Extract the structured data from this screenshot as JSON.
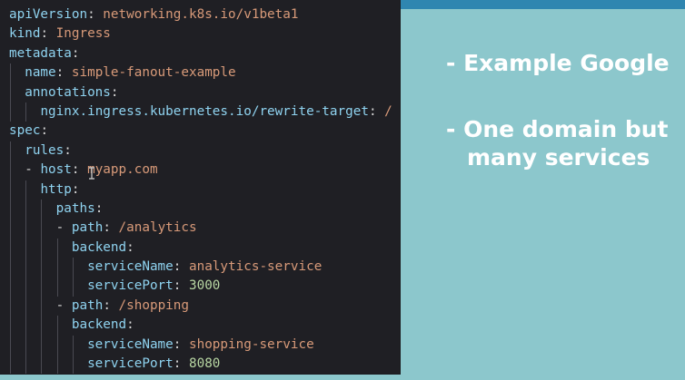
{
  "code_lines": [
    {
      "indent": 0,
      "key": "apiVersion",
      "sep": ": ",
      "value": "networking.k8s.io/v1beta1"
    },
    {
      "indent": 0,
      "key": "kind",
      "sep": ": ",
      "value": "Ingress"
    },
    {
      "indent": 0,
      "key": "metadata",
      "sep": ":",
      "value": ""
    },
    {
      "indent": 1,
      "key": "name",
      "sep": ": ",
      "value": "simple-fanout-example"
    },
    {
      "indent": 1,
      "key": "annotations",
      "sep": ":",
      "value": ""
    },
    {
      "indent": 2,
      "key": "nginx.ingress.kubernetes.io/rewrite-target",
      "sep": ": ",
      "value": "/"
    },
    {
      "indent": 0,
      "key": "spec",
      "sep": ":",
      "value": ""
    },
    {
      "indent": 1,
      "key": "rules",
      "sep": ":",
      "value": ""
    },
    {
      "indent": 1,
      "dash": "- ",
      "key": "host",
      "sep": ": ",
      "value": "myapp.com"
    },
    {
      "indent": 2,
      "key": "http",
      "sep": ":",
      "value": ""
    },
    {
      "indent": 3,
      "key": "paths",
      "sep": ":",
      "value": ""
    },
    {
      "indent": 3,
      "dash": "- ",
      "key": "path",
      "sep": ": ",
      "value": "/analytics"
    },
    {
      "indent": 4,
      "key": "backend",
      "sep": ":",
      "value": ""
    },
    {
      "indent": 5,
      "key": "serviceName",
      "sep": ": ",
      "value": "analytics-service"
    },
    {
      "indent": 5,
      "key": "servicePort",
      "sep": ": ",
      "value": "3000",
      "numeric": true
    },
    {
      "indent": 3,
      "dash": "- ",
      "key": "path",
      "sep": ": ",
      "value": "/shopping"
    },
    {
      "indent": 4,
      "key": "backend",
      "sep": ":",
      "value": ""
    },
    {
      "indent": 5,
      "key": "serviceName",
      "sep": ": ",
      "value": "shopping-service"
    },
    {
      "indent": 5,
      "key": "servicePort",
      "sep": ": ",
      "value": "8080",
      "numeric": true
    }
  ],
  "slide": {
    "bullet_1": "- Example Google",
    "bullet_2_line_1": "- One domain but",
    "bullet_2_line_2": "many services"
  },
  "colors": {
    "background": "#8cc7cc",
    "editor_background": "#1f1f24",
    "key": "#8fd3f0",
    "string_value": "#d89a79",
    "number_value": "#b8d7a3",
    "slide_text": "#ffffff"
  },
  "icons": {
    "cursor": "text-cursor-icon"
  }
}
